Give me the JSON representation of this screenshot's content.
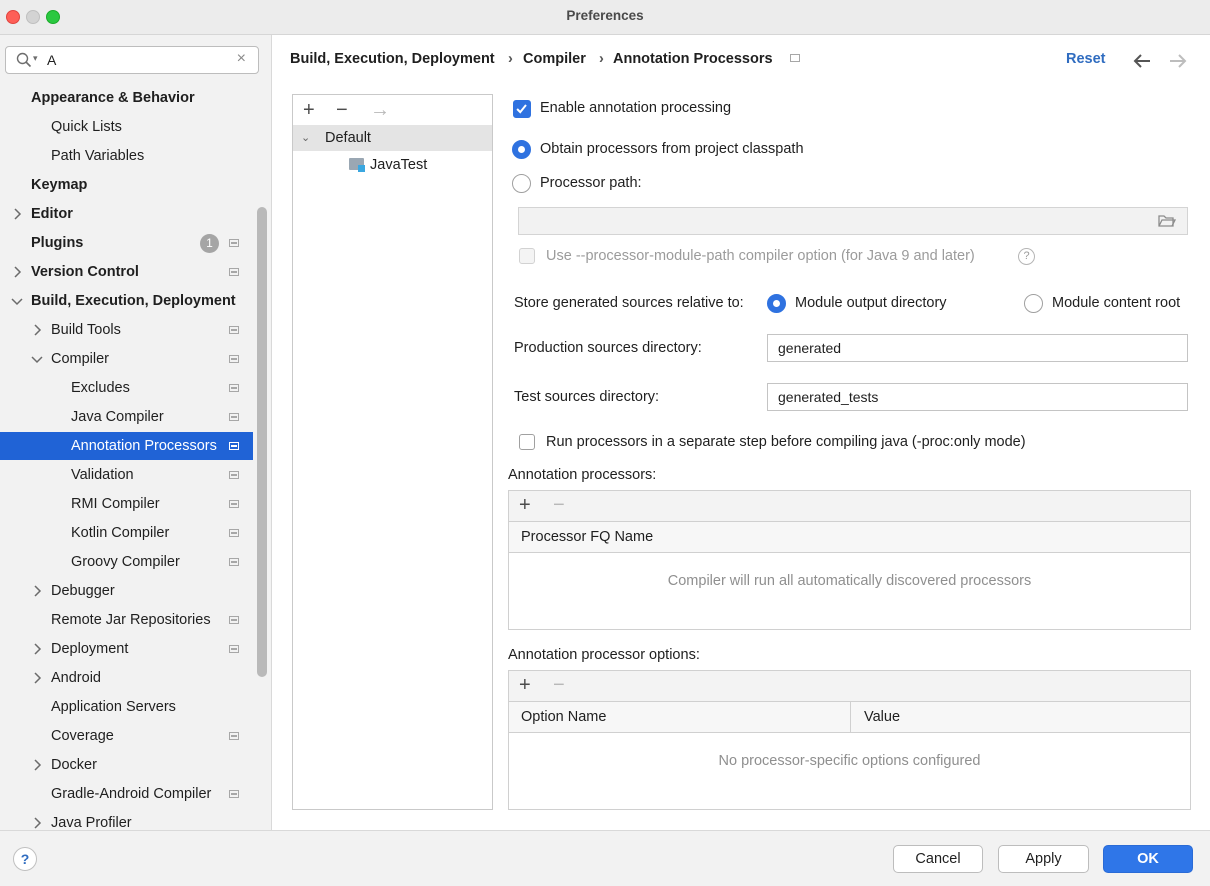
{
  "window": {
    "title": "Preferences"
  },
  "search": {
    "value": "A"
  },
  "sidebar": {
    "items": [
      {
        "label": "Appearance & Behavior",
        "bold": true,
        "arrow": "none",
        "level": 0
      },
      {
        "label": "Quick Lists",
        "level": 1,
        "arrow": "none"
      },
      {
        "label": "Path Variables",
        "level": 1,
        "arrow": "none"
      },
      {
        "label": "Keymap",
        "bold": true,
        "level": 0,
        "arrow": "none"
      },
      {
        "label": "Editor",
        "bold": true,
        "level": 0,
        "arrow": "right"
      },
      {
        "label": "Plugins",
        "bold": true,
        "level": 0,
        "arrow": "none",
        "badge": "1",
        "page_icon": true
      },
      {
        "label": "Version Control",
        "bold": true,
        "level": 0,
        "arrow": "right",
        "page_icon": true
      },
      {
        "label": "Build, Execution, Deployment",
        "bold": true,
        "level": 0,
        "arrow": "down"
      },
      {
        "label": "Build Tools",
        "level": 1,
        "arrow": "right",
        "page_icon": true
      },
      {
        "label": "Compiler",
        "level": 1,
        "arrow": "down",
        "page_icon": true
      },
      {
        "label": "Excludes",
        "level": 2,
        "arrow": "none",
        "page_icon": true
      },
      {
        "label": "Java Compiler",
        "level": 2,
        "arrow": "none",
        "page_icon": true
      },
      {
        "label": "Annotation Processors",
        "level": 2,
        "arrow": "none",
        "page_icon": true,
        "selected": true
      },
      {
        "label": "Validation",
        "level": 2,
        "arrow": "none",
        "page_icon": true
      },
      {
        "label": "RMI Compiler",
        "level": 2,
        "arrow": "none",
        "page_icon": true
      },
      {
        "label": "Kotlin Compiler",
        "level": 2,
        "arrow": "none",
        "page_icon": true
      },
      {
        "label": "Groovy Compiler",
        "level": 2,
        "arrow": "none",
        "page_icon": true
      },
      {
        "label": "Debugger",
        "level": 1,
        "arrow": "right"
      },
      {
        "label": "Remote Jar Repositories",
        "level": 1,
        "arrow": "none",
        "page_icon": true
      },
      {
        "label": "Deployment",
        "level": 1,
        "arrow": "right",
        "page_icon": true
      },
      {
        "label": "Android",
        "level": 1,
        "arrow": "right"
      },
      {
        "label": "Application Servers",
        "level": 1,
        "arrow": "none"
      },
      {
        "label": "Coverage",
        "level": 1,
        "arrow": "none",
        "page_icon": true
      },
      {
        "label": "Docker",
        "level": 1,
        "arrow": "right"
      },
      {
        "label": "Gradle-Android Compiler",
        "level": 1,
        "arrow": "none",
        "page_icon": true
      },
      {
        "label": "Java Profiler",
        "level": 1,
        "arrow": "right"
      }
    ]
  },
  "breadcrumb": {
    "items": [
      "Build, Execution, Deployment",
      "Compiler",
      "Annotation Processors"
    ],
    "separator": "›",
    "reset_label": "Reset"
  },
  "modules": {
    "toolbar": {
      "add": "+",
      "remove": "−",
      "move": "→"
    },
    "profile": "Default",
    "module": "JavaTest"
  },
  "settings": {
    "enable_label": "Enable annotation processing",
    "enable_checked": true,
    "obtain_classpath_label": "Obtain processors from project classpath",
    "processor_path_label": "Processor path:",
    "processor_path_value": "",
    "module_path_label": "Use --processor-module-path compiler option (for Java 9 and later)",
    "store_label": "Store generated sources relative to:",
    "module_output_label": "Module output directory",
    "module_content_label": "Module content root",
    "production_label": "Production sources directory:",
    "production_value": "generated",
    "test_label": "Test sources directory:",
    "test_value": "generated_tests",
    "separate_step_label": "Run processors in a separate step before compiling java (-proc:only mode)"
  },
  "processors_table": {
    "title": "Annotation processors:",
    "add": "+",
    "remove": "−",
    "column": "Processor FQ Name",
    "empty_text": "Compiler will run all automatically discovered processors"
  },
  "options_table": {
    "title": "Annotation processor options:",
    "add": "+",
    "remove": "−",
    "columns": [
      "Option Name",
      "Value"
    ],
    "empty_text": "No processor-specific options configured"
  },
  "footer": {
    "help": "?",
    "cancel": "Cancel",
    "apply": "Apply",
    "ok": "OK"
  },
  "colors": {
    "accent": "#2f72e0",
    "selection": "#2063d6",
    "link": "#2f6cc0"
  }
}
